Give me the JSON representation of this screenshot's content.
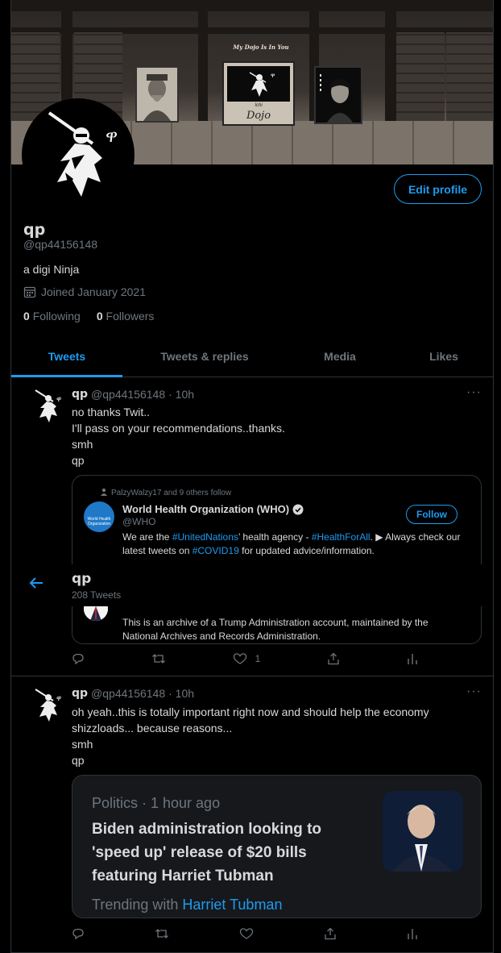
{
  "banner": {
    "sign_top": "My Dojo Is In You",
    "sign_small": "Ichi",
    "sign_big": "Dojo"
  },
  "profile": {
    "name": "qp",
    "handle": "@qp44156148",
    "bio": "a digi Ninja",
    "joined": "Joined January 2021",
    "following_count": "0",
    "following_label": "Following",
    "followers_count": "0",
    "followers_label": "Followers",
    "edit_label": "Edit profile"
  },
  "tabs": [
    {
      "label": "Tweets",
      "active": true
    },
    {
      "label": "Tweets & replies",
      "active": false
    },
    {
      "label": "Media",
      "active": false
    },
    {
      "label": "Likes",
      "active": false
    }
  ],
  "sticky_header": {
    "name": "qp",
    "tweet_count": "208 Tweets"
  },
  "tweets": [
    {
      "name": "qp",
      "handle": "@qp44156148",
      "time": "· 10h",
      "lines": [
        "no thanks Twit..",
        "I'll pass on your recommendations..thanks.",
        "smh",
        "qp"
      ],
      "card": {
        "context": "PalzyWalzy17 and 9 others follow",
        "account_name": "World Health Organization (WHO)",
        "account_handle": "@WHO",
        "logo_text": "World Health Organization",
        "follow_label": "Follow",
        "desc_parts": [
          "We are the ",
          "#UnitedNations",
          "’ health agency - ",
          "#HealthForAll",
          ". ▶ Always check our latest tweets on ",
          "#COVID19",
          " for updated advice/information."
        ],
        "second_desc": "This is an archive of a Trump Administration account, maintained by the National Archives and Records Administration."
      },
      "likes": "1"
    },
    {
      "name": "qp",
      "handle": "@qp44156148",
      "time": "· 10h",
      "lines": [
        "oh yeah..this is totally important right now and should help the economy shizzloads... because reasons...",
        "smh",
        "qp"
      ],
      "news": {
        "meta": "Politics · 1 hour ago",
        "title": "Biden administration looking to 'speed up' release of $20 bills featuring Harriet Tubman",
        "trend_label": "Trending with",
        "trend_link": "Harriet Tubman"
      }
    }
  ],
  "colors": {
    "accent": "#1d9bf0",
    "muted": "#6e767d",
    "border": "#2f3336",
    "bg": "#000000"
  }
}
